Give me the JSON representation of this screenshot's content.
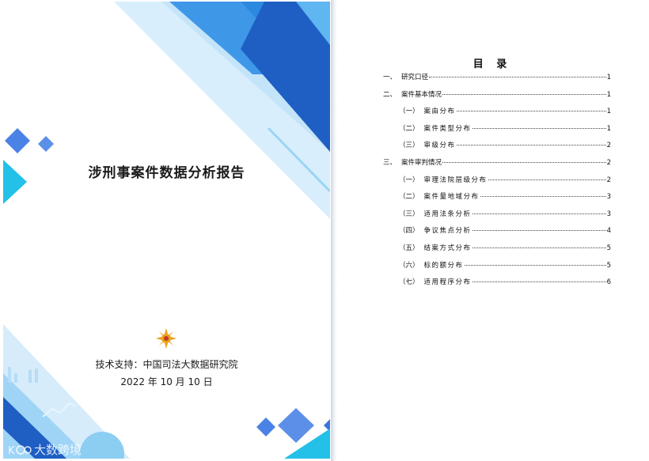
{
  "cover": {
    "title": "涉刑事案件数据分析报告",
    "support": "技术支持：中国司法大数据研究院",
    "date": "2022 年 10 月 10 日",
    "watermark": "大数跨境",
    "colors": {
      "deep_blue": "#1f5fc4",
      "mid_blue": "#3d8ee6",
      "light_blue": "#d6ecfb",
      "cyan": "#23c0e8",
      "emblem": "#e8a21a"
    }
  },
  "toc": {
    "heading": "目  录",
    "entries": [
      {
        "num": "一、",
        "label": "研究口径",
        "page": "1",
        "level": 1
      },
      {
        "num": "二、",
        "label": "案件基本情况",
        "page": "1",
        "level": 1
      },
      {
        "num": "（一）",
        "label": "案由分布",
        "page": "1",
        "level": 2
      },
      {
        "num": "（二）",
        "label": "案件类型分布",
        "page": "1",
        "level": 2
      },
      {
        "num": "（三）",
        "label": "审级分布",
        "page": "2",
        "level": 2
      },
      {
        "num": "三、",
        "label": "案件审判情况",
        "page": "2",
        "level": 1
      },
      {
        "num": "（一）",
        "label": "审理法院层级分布",
        "page": "2",
        "level": 2
      },
      {
        "num": "（二）",
        "label": "案件量地域分布",
        "page": "3",
        "level": 2
      },
      {
        "num": "（三）",
        "label": "适用法条分析",
        "page": "3",
        "level": 2
      },
      {
        "num": "（四）",
        "label": "争议焦点分析",
        "page": "4",
        "level": 2
      },
      {
        "num": "（五）",
        "label": "结案方式分布",
        "page": "5",
        "level": 2
      },
      {
        "num": "（六）",
        "label": "标的额分布",
        "page": "5",
        "level": 2
      },
      {
        "num": "（七）",
        "label": "适用程序分布",
        "page": "6",
        "level": 2
      }
    ]
  }
}
